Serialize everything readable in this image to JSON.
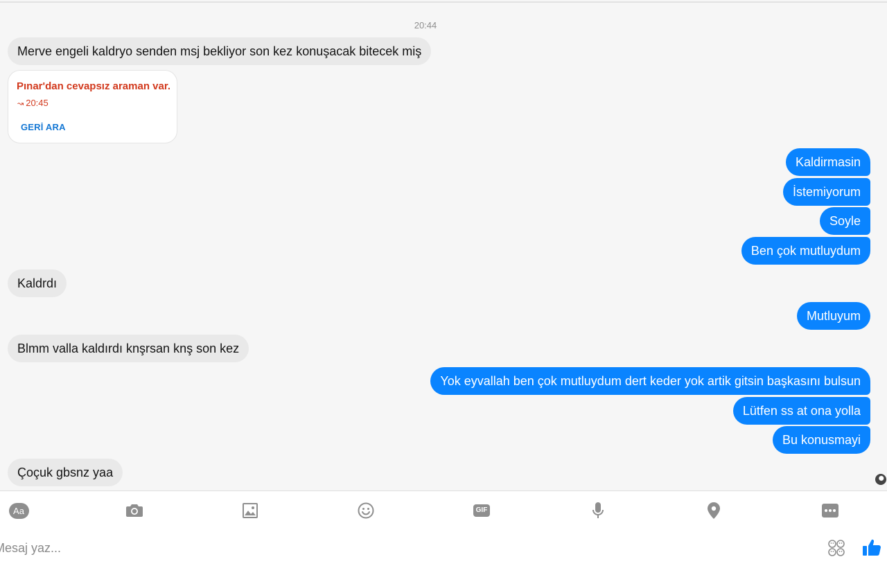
{
  "chat": {
    "timestamp": "20:44",
    "messages": [
      "Merve engeli kaldryo senden msj bekliyor son kez konuşacak bitecek miş",
      "Kaldirmasin",
      "İstemiyorum",
      "Soyle",
      "Ben çok mutluydum",
      "Kaldrdı",
      "Mutluyum",
      "Blmm valla kaldırdı knşrsan knş son kez",
      "Yok eyvallah ben çok mutluydum dert keder yok artik gitsin başkasını bulsun",
      "Lütfen ss at ona yolla",
      "Bu konusmayi",
      "Çoçuk gbsnz yaa"
    ],
    "missed_call": {
      "title": "Pınar'dan cevapsız araman var.",
      "time": "20:45",
      "button": "GERİ ARA"
    }
  },
  "composer": {
    "aa_label": "Aa",
    "gif_label": "GIF",
    "placeholder": "Mesaj yaz...",
    "icons": [
      "text-style-icon",
      "camera-icon",
      "image-icon",
      "emoji-icon",
      "gif-icon",
      "microphone-icon",
      "location-icon",
      "more-icon",
      "sticker-icon",
      "like-icon"
    ]
  },
  "colors": {
    "outgoing_bubble": "#0a84ff",
    "incoming_bubble": "#e9e9e9",
    "missed_call_text": "#d23a1e",
    "link_blue": "#1477d4",
    "icon_gray": "#8e8e8e"
  }
}
